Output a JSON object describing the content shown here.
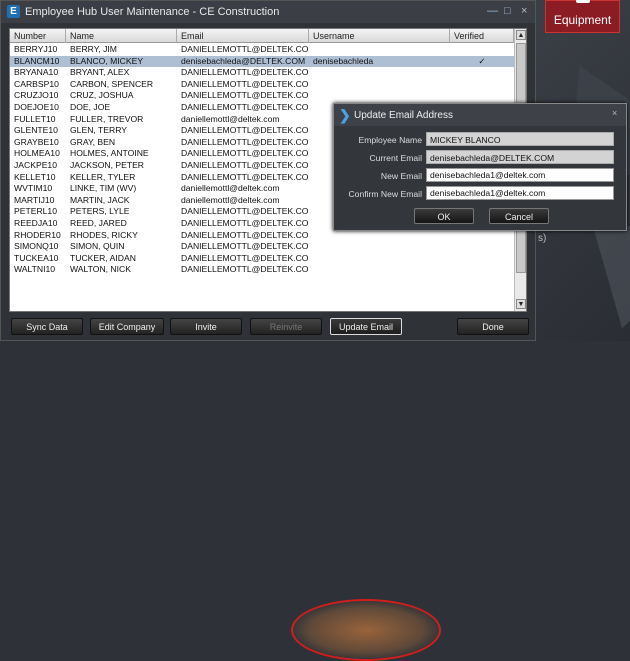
{
  "window": {
    "title": "Employee Hub User Maintenance - CE Construction",
    "app_icon": "E",
    "controls": {
      "minimize": "—",
      "maximize": "□",
      "close": "×"
    }
  },
  "desktop": {
    "tile_label": "Equipment",
    "side_text": "s)"
  },
  "grid": {
    "columns": [
      "Number",
      "Name",
      "Email",
      "Username",
      "Verified"
    ],
    "rows": [
      {
        "number": "BERRYJ10",
        "name": "BERRY, JIM",
        "email": "DANIELLEMOTTL@DELTEK.COM",
        "username": "",
        "verified": ""
      },
      {
        "number": "BLANCM10",
        "name": "BLANCO, MICKEY",
        "email": "denisebachleda@DELTEK.COM",
        "username": "denisebachleda",
        "verified": "✓"
      },
      {
        "number": "BRYANA10",
        "name": "BRYANT, ALEX",
        "email": "DANIELLEMOTTL@DELTEK.COM",
        "username": "",
        "verified": ""
      },
      {
        "number": "CARBSP10",
        "name": "CARBON, SPENCER",
        "email": "DANIELLEMOTTL@DELTEK.COM",
        "username": "",
        "verified": ""
      },
      {
        "number": "CRUZJO10",
        "name": "CRUZ, JOSHUA",
        "email": "DANIELLEMOTTL@DELTEK.COM",
        "username": "",
        "verified": ""
      },
      {
        "number": "DOEJOE10",
        "name": "DOE, JOE",
        "email": "DANIELLEMOTTL@DELTEK.COM",
        "username": "",
        "verified": ""
      },
      {
        "number": "FULLET10",
        "name": "FULLER, TREVOR",
        "email": "daniellemottl@deltek.com",
        "username": "",
        "verified": ""
      },
      {
        "number": "GLENTE10",
        "name": "GLEN, TERRY",
        "email": "DANIELLEMOTTL@DELTEK.COM",
        "username": "",
        "verified": ""
      },
      {
        "number": "GRAYBE10",
        "name": "GRAY, BEN",
        "email": "DANIELLEMOTTL@DELTEK.COM",
        "username": "",
        "verified": ""
      },
      {
        "number": "HOLMEA10",
        "name": "HOLMES, ANTOINE",
        "email": "DANIELLEMOTTL@DELTEK.COM",
        "username": "",
        "verified": ""
      },
      {
        "number": "JACKPE10",
        "name": "JACKSON, PETER",
        "email": "DANIELLEMOTTL@DELTEK.COM",
        "username": "",
        "verified": ""
      },
      {
        "number": "KELLET10",
        "name": "KELLER, TYLER",
        "email": "DANIELLEMOTTL@DELTEK.COM",
        "username": "",
        "verified": ""
      },
      {
        "number": "WVTIM10",
        "name": "LINKE, TIM (WV)",
        "email": "daniellemottl@deltek.com",
        "username": "",
        "verified": ""
      },
      {
        "number": "MARTIJ10",
        "name": "MARTIN, JACK",
        "email": "daniellemottl@deltek.com",
        "username": "",
        "verified": ""
      },
      {
        "number": "PETERL10",
        "name": "PETERS, LYLE",
        "email": "DANIELLEMOTTL@DELTEK.COM",
        "username": "",
        "verified": ""
      },
      {
        "number": "REEDJA10",
        "name": "REED, JARED",
        "email": "DANIELLEMOTTL@DELTEK.COM",
        "username": "",
        "verified": ""
      },
      {
        "number": "RHODER10",
        "name": "RHODES, RICKY",
        "email": "DANIELLEMOTTL@DELTEK.COM",
        "username": "",
        "verified": ""
      },
      {
        "number": "SIMONQ10",
        "name": "SIMON, QUIN",
        "email": "DANIELLEMOTTL@DELTEK.COM",
        "username": "",
        "verified": ""
      },
      {
        "number": "TUCKEA10",
        "name": "TUCKER, AIDAN",
        "email": "DANIELLEMOTTL@DELTEK.COM",
        "username": "",
        "verified": ""
      },
      {
        "number": "WALTNI10",
        "name": "WALTON, NICK",
        "email": "DANIELLEMOTTL@DELTEK.COM",
        "username": "",
        "verified": ""
      }
    ],
    "selected_row": 1
  },
  "buttons": {
    "sync_data": "Sync Data",
    "edit_company": "Edit Company",
    "invite": "Invite",
    "reinvite": "Reinvite",
    "update_email": "Update Email",
    "done": "Done"
  },
  "dialog": {
    "title": "Update Email Address",
    "close": "×",
    "employee_name_label": "Employee Name",
    "employee_name_value": "MICKEY BLANCO",
    "current_email_label": "Current Email",
    "current_email_value": "denisebachleda@DELTEK.COM",
    "new_email_label": "New Email",
    "new_email_value": "denisebachleda1@deltek.com",
    "confirm_email_label": "Confirm New Email",
    "confirm_email_value": "denisebachleda1@deltek.com",
    "ok": "OK",
    "cancel": "Cancel"
  },
  "colors": {
    "selected_row": "#aebed3",
    "highlight_ring": "#d21d1d",
    "tile": "#8b1c24",
    "accent": "#4aa3e8"
  }
}
